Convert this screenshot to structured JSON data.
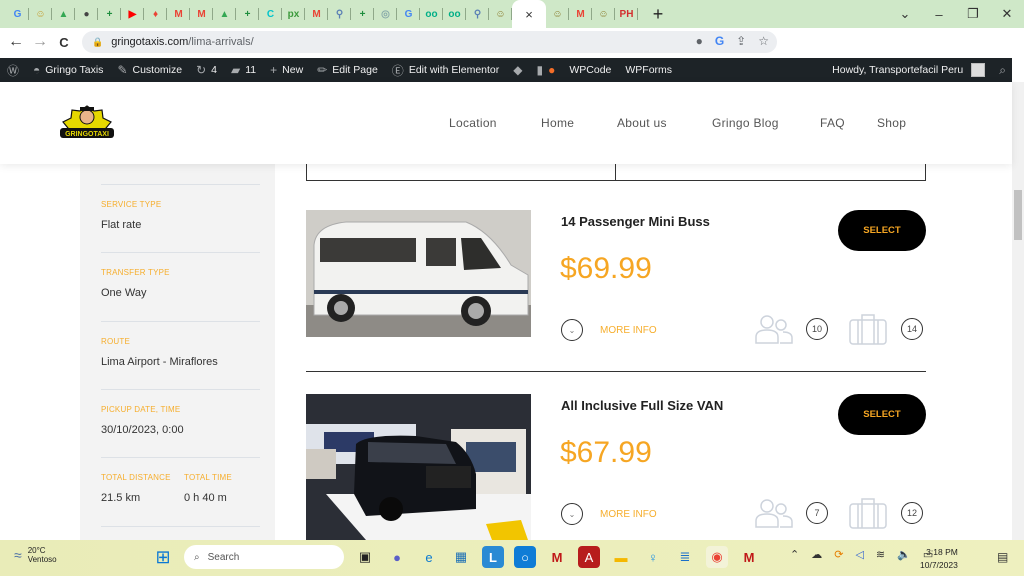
{
  "browser": {
    "tabs": [
      {
        "icon": "google-icon",
        "glyph": "G",
        "color": "#4285f4"
      },
      {
        "icon": "gringo-icon",
        "glyph": "☺",
        "color": "#c59b2b"
      },
      {
        "icon": "drive-icon",
        "glyph": "▲",
        "color": "#34a853"
      },
      {
        "icon": "globe-icon",
        "glyph": "●",
        "color": "#444"
      },
      {
        "icon": "sheets-icon",
        "glyph": "+",
        "color": "#1e8e3e"
      },
      {
        "icon": "youtube-icon",
        "glyph": "▶",
        "color": "#ff0000"
      },
      {
        "icon": "maps-icon",
        "glyph": "♦",
        "color": "#ea4335"
      },
      {
        "icon": "gmail-icon",
        "glyph": "M",
        "color": "#ea4335"
      },
      {
        "icon": "gmail-icon",
        "glyph": "M",
        "color": "#ea4335"
      },
      {
        "icon": "drive-icon",
        "glyph": "▲",
        "color": "#34a853"
      },
      {
        "icon": "sheets-icon",
        "glyph": "+",
        "color": "#1e8e3e"
      },
      {
        "icon": "canva-icon",
        "glyph": "C",
        "color": "#00c4cc"
      },
      {
        "icon": "px-icon",
        "glyph": "px",
        "color": "#3c9a3c"
      },
      {
        "icon": "gmail-icon",
        "glyph": "M",
        "color": "#ea4335"
      },
      {
        "icon": "tool-icon",
        "glyph": "⚲",
        "color": "#5a7fb5"
      },
      {
        "icon": "sheets-icon",
        "glyph": "+",
        "color": "#1e8e3e"
      },
      {
        "icon": "chatgpt-icon",
        "glyph": "◎",
        "color": "#8aa"
      },
      {
        "icon": "google-icon",
        "glyph": "G",
        "color": "#4285f4"
      },
      {
        "icon": "tripadvisor-icon",
        "glyph": "oo",
        "color": "#00af87"
      },
      {
        "icon": "tripadvisor-icon",
        "glyph": "oo",
        "color": "#00af87"
      },
      {
        "icon": "tool-icon",
        "glyph": "⚲",
        "color": "#5a7fb5"
      },
      {
        "icon": "gringo-icon",
        "glyph": "☺",
        "color": "#8a7a2b"
      }
    ],
    "active_tab_close": "×",
    "tabs_after": [
      {
        "icon": "gringo-icon",
        "glyph": "☺",
        "color": "#8a7a2b"
      },
      {
        "icon": "gmail-icon",
        "glyph": "M",
        "color": "#ea4335"
      },
      {
        "icon": "gringo-icon",
        "glyph": "☺",
        "color": "#8a7a2b"
      },
      {
        "icon": "ph-icon",
        "glyph": "PH",
        "color": "#d32f2f"
      }
    ],
    "new_tab": "+",
    "window_controls": {
      "dropdown": "⌄",
      "minimize": "–",
      "maximize": "❐",
      "close": "✕"
    },
    "nav": {
      "back": "←",
      "forward": "→",
      "reload": "C"
    },
    "url_host": "gringotaxis.com",
    "url_path": "/lima-arrivals/",
    "omni_icons": [
      "●",
      "G",
      "⇪",
      "☆"
    ]
  },
  "wp_admin": {
    "site_name": "Gringo Taxis",
    "customize": "Customize",
    "updates": "4",
    "comments": "11",
    "new": "New",
    "edit_page": "Edit Page",
    "edit_elementor": "Edit with Elementor",
    "wpcode": "WPCode",
    "wpforms": "WPForms",
    "howdy": "Howdy, Transportefacil Peru"
  },
  "site": {
    "logo_text": "GRINGOTAXI",
    "menu": [
      "Location",
      "Home",
      "About us",
      "Gringo Blog",
      "FAQ",
      "Shop"
    ]
  },
  "summary": {
    "service_type_label": "SERVICE TYPE",
    "service_type": "Flat rate",
    "transfer_type_label": "TRANSFER TYPE",
    "transfer_type": "One Way",
    "route_label": "ROUTE",
    "route": "Lima Airport - Miraflores",
    "pickup_label": "PICKUP DATE, TIME",
    "pickup": "30/10/2023, 0:00",
    "distance_label": "TOTAL DISTANCE",
    "distance": "21.5 km",
    "time_label": "TOTAL TIME",
    "time": "0 h 40 m"
  },
  "vehicles": [
    {
      "name": "14 Passenger Mini Buss",
      "price": "$69.99",
      "select": "SELECT",
      "more_info": "MORE INFO",
      "passengers": "10",
      "luggage": "14"
    },
    {
      "name": "All Inclusive Full Size VAN",
      "price": "$67.99",
      "select": "SELECT",
      "more_info": "MORE INFO",
      "passengers": "7",
      "luggage": "12"
    }
  ],
  "taskbar": {
    "temp": "20°C",
    "weather": "Ventoso",
    "search": "Search",
    "time": "3:18 PM",
    "date": "10/7/2023"
  }
}
